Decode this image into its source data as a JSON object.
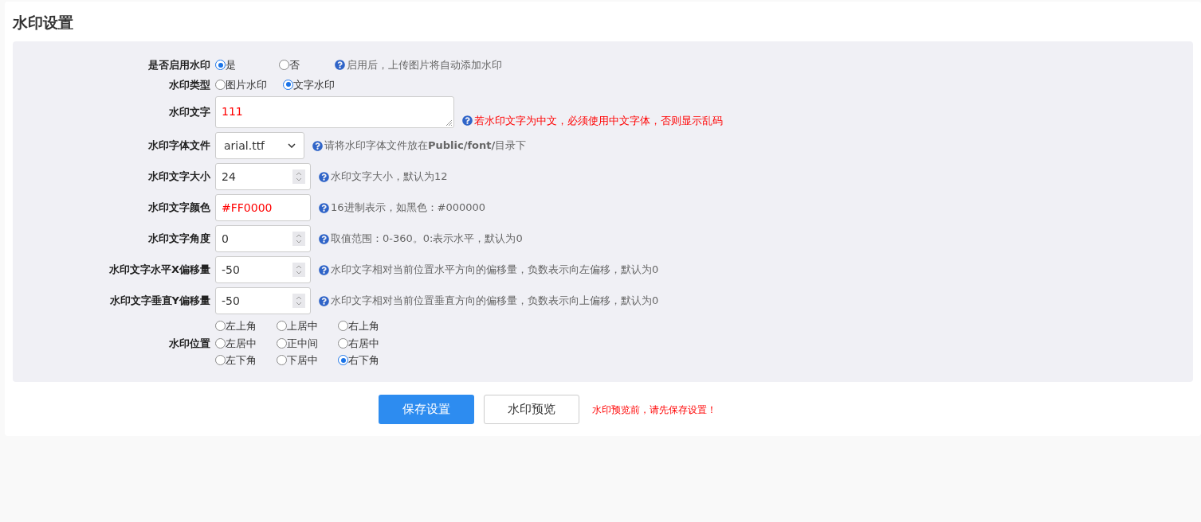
{
  "title": "水印设置",
  "fields": [
    {
      "kind": "radio",
      "label": "是否启用水印",
      "options": [
        {
          "label": "是",
          "selected": true
        },
        {
          "label": "否",
          "selected": false
        }
      ],
      "hint": {
        "text": "启用后，上传图片将自动添加水印",
        "warning": false
      }
    },
    {
      "kind": "radio",
      "label": "水印类型",
      "options": [
        {
          "label": "图片水印",
          "selected": false
        },
        {
          "label": "文字水印",
          "selected": true
        }
      ]
    },
    {
      "kind": "textarea",
      "label": "水印文字",
      "value": "111",
      "value_red": true,
      "hint": {
        "text": "若水印文字为中文，必须使用中文字体，否则显示乱码",
        "warning": true
      }
    },
    {
      "kind": "select",
      "label": "水印字体文件",
      "value": "arial.ttf",
      "hint": {
        "text": "请将水印字体文件放在**Public/font/**目录下",
        "warning": false
      }
    },
    {
      "kind": "number",
      "label": "水印文字大小",
      "value": "24",
      "hint": {
        "text": "水印文字大小，默认为12",
        "warning": false
      }
    },
    {
      "kind": "text",
      "label": "水印文字颜色",
      "value": "#FF0000",
      "value_red": true,
      "hint": {
        "text": "16进制表示，如黑色：#000000",
        "warning": false
      }
    },
    {
      "kind": "number",
      "label": "水印文字角度",
      "value": "0",
      "hint": {
        "text": "取值范围：0-360。0:表示水平，默认为0",
        "warning": false
      }
    },
    {
      "kind": "number",
      "label": "水印文字水平X偏移量",
      "value": "-50",
      "hint": {
        "text": "水印文字相对当前位置水平方向的偏移量，负数表示向左偏移，默认为0",
        "warning": false
      }
    },
    {
      "kind": "number",
      "label": "水印文字垂直Y偏移量",
      "value": "-50",
      "hint": {
        "text": "水印文字相对当前位置垂直方向的偏移量，负数表示向上偏移，默认为0",
        "warning": false
      }
    },
    {
      "kind": "grid",
      "label": "水印位置",
      "options": [
        {
          "label": "左上角",
          "selected": false
        },
        {
          "label": "上居中",
          "selected": false
        },
        {
          "label": "右上角",
          "selected": false
        },
        {
          "label": "左居中",
          "selected": false
        },
        {
          "label": "正中间",
          "selected": false
        },
        {
          "label": "右居中",
          "selected": false
        },
        {
          "label": "左下角",
          "selected": false
        },
        {
          "label": "下居中",
          "selected": false
        },
        {
          "label": "右下角",
          "selected": true
        }
      ]
    }
  ],
  "buttons": [
    {
      "label": "保存设置",
      "primary": true
    },
    {
      "label": "水印预览",
      "primary": false
    }
  ],
  "footer_note": "水印预览前，请先保存设置！"
}
